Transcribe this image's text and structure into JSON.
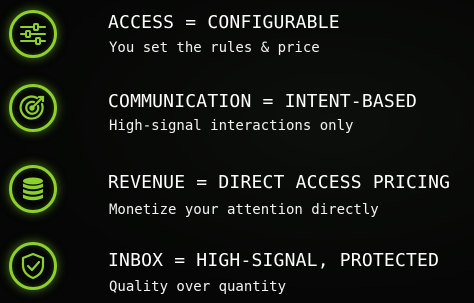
{
  "accent_color": "#8bd12a",
  "features": [
    {
      "icon": "sliders-icon",
      "title": "ACCESS = CONFIGURABLE",
      "subtitle": "You set the rules & price"
    },
    {
      "icon": "target-icon",
      "title": "COMMUNICATION = INTENT-BASED",
      "subtitle": "High-signal interactions only"
    },
    {
      "icon": "coin-stack-icon",
      "title": "REVENUE = DIRECT ACCESS PRICING",
      "subtitle": "Monetize your attention directly"
    },
    {
      "icon": "shield-check-icon",
      "title": "INBOX = HIGH-SIGNAL, PROTECTED",
      "subtitle": "Quality over quantity"
    }
  ]
}
